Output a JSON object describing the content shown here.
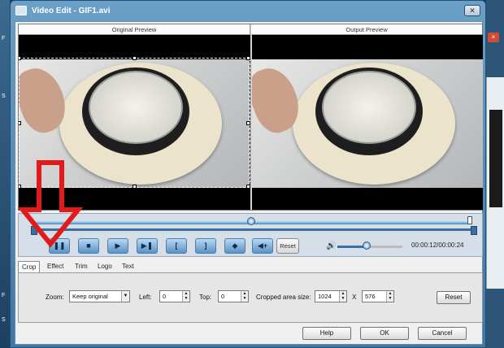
{
  "background": {
    "left_letters": [
      "F",
      "S",
      "F",
      "S"
    ],
    "right_close": "×"
  },
  "window": {
    "title": "Video Edit - GIF1.avi",
    "close_label": "✕"
  },
  "preview": {
    "original_title": "Original Preview",
    "output_title": "Output Preview"
  },
  "player": {
    "position_fraction": 0.5,
    "buttons": [
      {
        "name": "pause-button",
        "icon": "pause-icon",
        "glyph": "❚❚"
      },
      {
        "name": "stop-button",
        "icon": "stop-icon",
        "glyph": "■"
      },
      {
        "name": "play-button",
        "icon": "play-icon",
        "glyph": "▶"
      },
      {
        "name": "next-frame-button",
        "icon": "next-frame-icon",
        "glyph": "▶❚"
      },
      {
        "name": "mark-in-button",
        "icon": "bracket-left-icon",
        "glyph": "["
      },
      {
        "name": "mark-out-button",
        "icon": "bracket-right-icon",
        "glyph": "]"
      },
      {
        "name": "snapshot-button",
        "icon": "snapshot-icon",
        "glyph": "◆"
      },
      {
        "name": "add-segment-button",
        "icon": "add-segment-icon",
        "glyph": "◀+"
      }
    ],
    "reset_label": "Reset",
    "volume_fraction": 0.45,
    "time": "00:00:12/00:00:24"
  },
  "tabs": [
    {
      "label": "Crop",
      "active": true
    },
    {
      "label": "Effect",
      "active": false
    },
    {
      "label": "Trim",
      "active": false
    },
    {
      "label": "Logo",
      "active": false
    },
    {
      "label": "Text",
      "active": false
    }
  ],
  "crop": {
    "zoom_label": "Zoom:",
    "zoom_value": "Keep original",
    "left_label": "Left:",
    "left_value": "0",
    "top_label": "Top:",
    "top_value": "0",
    "size_label": "Cropped area size:",
    "width_value": "1024",
    "x_label": "X",
    "height_value": "576",
    "reset_label": "Reset"
  },
  "footer": {
    "help_label": "Help",
    "ok_label": "OK",
    "cancel_label": "Cancel"
  },
  "colors": {
    "annotation_arrow": "#e21a1a",
    "accent": "#3a6ea5"
  }
}
